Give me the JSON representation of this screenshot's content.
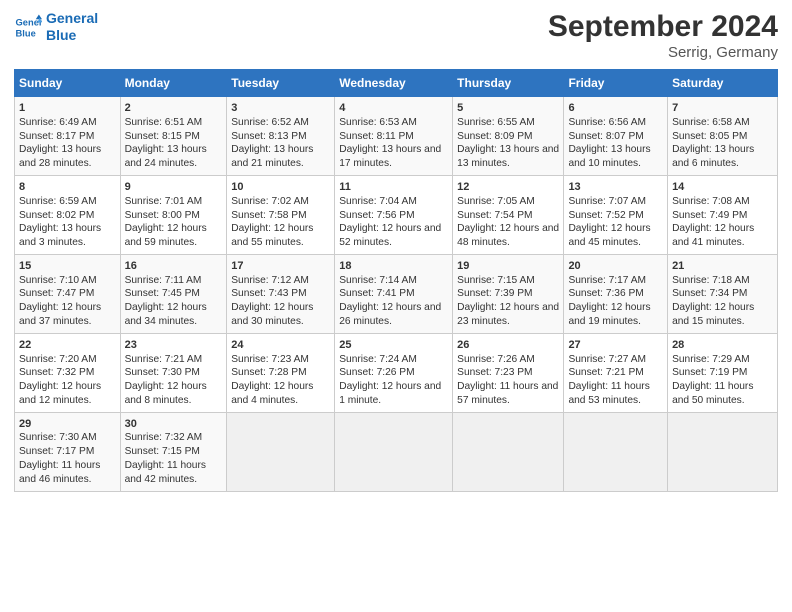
{
  "header": {
    "logo_line1": "General",
    "logo_line2": "Blue",
    "title": "September 2024",
    "subtitle": "Serrig, Germany"
  },
  "days_of_week": [
    "Sunday",
    "Monday",
    "Tuesday",
    "Wednesday",
    "Thursday",
    "Friday",
    "Saturday"
  ],
  "weeks": [
    [
      {
        "day": 1,
        "sunrise": "Sunrise: 6:49 AM",
        "sunset": "Sunset: 8:17 PM",
        "daylight": "Daylight: 13 hours and 28 minutes."
      },
      {
        "day": 2,
        "sunrise": "Sunrise: 6:51 AM",
        "sunset": "Sunset: 8:15 PM",
        "daylight": "Daylight: 13 hours and 24 minutes."
      },
      {
        "day": 3,
        "sunrise": "Sunrise: 6:52 AM",
        "sunset": "Sunset: 8:13 PM",
        "daylight": "Daylight: 13 hours and 21 minutes."
      },
      {
        "day": 4,
        "sunrise": "Sunrise: 6:53 AM",
        "sunset": "Sunset: 8:11 PM",
        "daylight": "Daylight: 13 hours and 17 minutes."
      },
      {
        "day": 5,
        "sunrise": "Sunrise: 6:55 AM",
        "sunset": "Sunset: 8:09 PM",
        "daylight": "Daylight: 13 hours and 13 minutes."
      },
      {
        "day": 6,
        "sunrise": "Sunrise: 6:56 AM",
        "sunset": "Sunset: 8:07 PM",
        "daylight": "Daylight: 13 hours and 10 minutes."
      },
      {
        "day": 7,
        "sunrise": "Sunrise: 6:58 AM",
        "sunset": "Sunset: 8:05 PM",
        "daylight": "Daylight: 13 hours and 6 minutes."
      }
    ],
    [
      {
        "day": 8,
        "sunrise": "Sunrise: 6:59 AM",
        "sunset": "Sunset: 8:02 PM",
        "daylight": "Daylight: 13 hours and 3 minutes."
      },
      {
        "day": 9,
        "sunrise": "Sunrise: 7:01 AM",
        "sunset": "Sunset: 8:00 PM",
        "daylight": "Daylight: 12 hours and 59 minutes."
      },
      {
        "day": 10,
        "sunrise": "Sunrise: 7:02 AM",
        "sunset": "Sunset: 7:58 PM",
        "daylight": "Daylight: 12 hours and 55 minutes."
      },
      {
        "day": 11,
        "sunrise": "Sunrise: 7:04 AM",
        "sunset": "Sunset: 7:56 PM",
        "daylight": "Daylight: 12 hours and 52 minutes."
      },
      {
        "day": 12,
        "sunrise": "Sunrise: 7:05 AM",
        "sunset": "Sunset: 7:54 PM",
        "daylight": "Daylight: 12 hours and 48 minutes."
      },
      {
        "day": 13,
        "sunrise": "Sunrise: 7:07 AM",
        "sunset": "Sunset: 7:52 PM",
        "daylight": "Daylight: 12 hours and 45 minutes."
      },
      {
        "day": 14,
        "sunrise": "Sunrise: 7:08 AM",
        "sunset": "Sunset: 7:49 PM",
        "daylight": "Daylight: 12 hours and 41 minutes."
      }
    ],
    [
      {
        "day": 15,
        "sunrise": "Sunrise: 7:10 AM",
        "sunset": "Sunset: 7:47 PM",
        "daylight": "Daylight: 12 hours and 37 minutes."
      },
      {
        "day": 16,
        "sunrise": "Sunrise: 7:11 AM",
        "sunset": "Sunset: 7:45 PM",
        "daylight": "Daylight: 12 hours and 34 minutes."
      },
      {
        "day": 17,
        "sunrise": "Sunrise: 7:12 AM",
        "sunset": "Sunset: 7:43 PM",
        "daylight": "Daylight: 12 hours and 30 minutes."
      },
      {
        "day": 18,
        "sunrise": "Sunrise: 7:14 AM",
        "sunset": "Sunset: 7:41 PM",
        "daylight": "Daylight: 12 hours and 26 minutes."
      },
      {
        "day": 19,
        "sunrise": "Sunrise: 7:15 AM",
        "sunset": "Sunset: 7:39 PM",
        "daylight": "Daylight: 12 hours and 23 minutes."
      },
      {
        "day": 20,
        "sunrise": "Sunrise: 7:17 AM",
        "sunset": "Sunset: 7:36 PM",
        "daylight": "Daylight: 12 hours and 19 minutes."
      },
      {
        "day": 21,
        "sunrise": "Sunrise: 7:18 AM",
        "sunset": "Sunset: 7:34 PM",
        "daylight": "Daylight: 12 hours and 15 minutes."
      }
    ],
    [
      {
        "day": 22,
        "sunrise": "Sunrise: 7:20 AM",
        "sunset": "Sunset: 7:32 PM",
        "daylight": "Daylight: 12 hours and 12 minutes."
      },
      {
        "day": 23,
        "sunrise": "Sunrise: 7:21 AM",
        "sunset": "Sunset: 7:30 PM",
        "daylight": "Daylight: 12 hours and 8 minutes."
      },
      {
        "day": 24,
        "sunrise": "Sunrise: 7:23 AM",
        "sunset": "Sunset: 7:28 PM",
        "daylight": "Daylight: 12 hours and 4 minutes."
      },
      {
        "day": 25,
        "sunrise": "Sunrise: 7:24 AM",
        "sunset": "Sunset: 7:26 PM",
        "daylight": "Daylight: 12 hours and 1 minute."
      },
      {
        "day": 26,
        "sunrise": "Sunrise: 7:26 AM",
        "sunset": "Sunset: 7:23 PM",
        "daylight": "Daylight: 11 hours and 57 minutes."
      },
      {
        "day": 27,
        "sunrise": "Sunrise: 7:27 AM",
        "sunset": "Sunset: 7:21 PM",
        "daylight": "Daylight: 11 hours and 53 minutes."
      },
      {
        "day": 28,
        "sunrise": "Sunrise: 7:29 AM",
        "sunset": "Sunset: 7:19 PM",
        "daylight": "Daylight: 11 hours and 50 minutes."
      }
    ],
    [
      {
        "day": 29,
        "sunrise": "Sunrise: 7:30 AM",
        "sunset": "Sunset: 7:17 PM",
        "daylight": "Daylight: 11 hours and 46 minutes."
      },
      {
        "day": 30,
        "sunrise": "Sunrise: 7:32 AM",
        "sunset": "Sunset: 7:15 PM",
        "daylight": "Daylight: 11 hours and 42 minutes."
      },
      null,
      null,
      null,
      null,
      null
    ]
  ]
}
